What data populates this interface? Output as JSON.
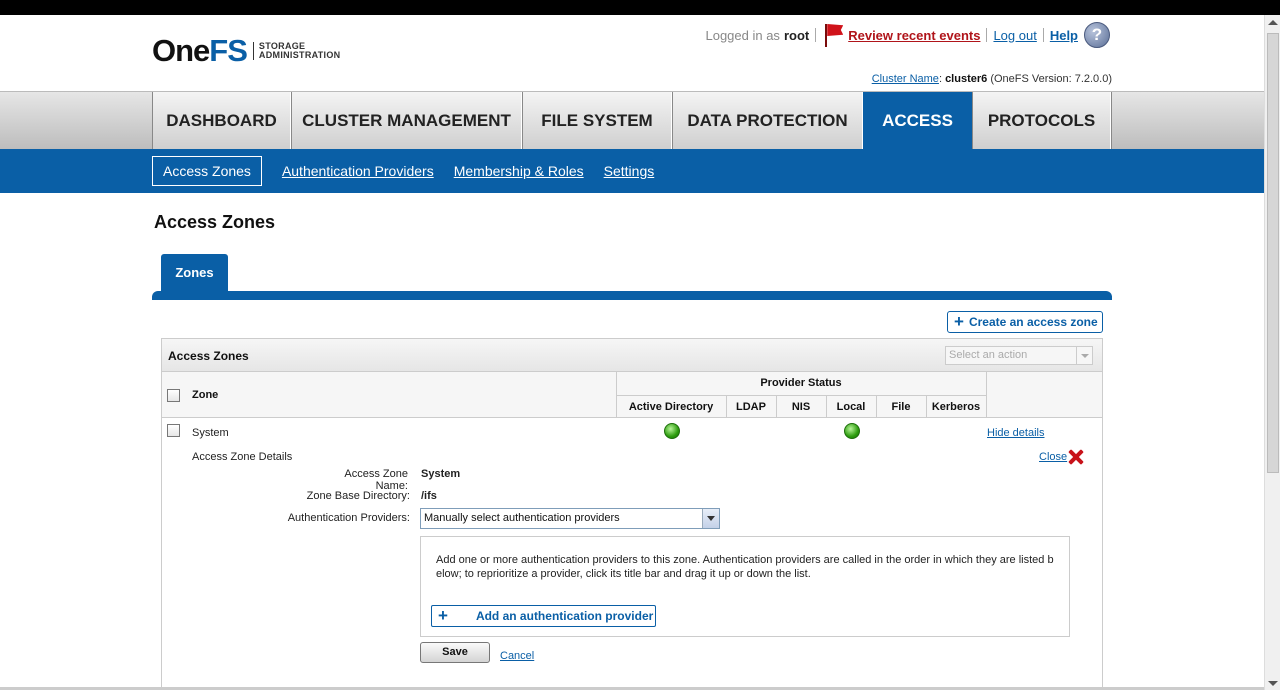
{
  "header": {
    "logo": {
      "one": "One",
      "fs": "FS",
      "sub_line1": "STORAGE",
      "sub_line2": "ADMINISTRATION"
    },
    "logged_in_label": "Logged in as",
    "username": "root",
    "review_events": "Review recent events",
    "logout": "Log out",
    "help": "Help",
    "help_glyph": "?",
    "cluster_name_label": "Cluster Name",
    "cluster_name": "cluster6",
    "version_text": "(OneFS Version: 7.2.0.0)"
  },
  "main_nav": {
    "tabs": [
      {
        "label": "DASHBOARD"
      },
      {
        "label": "CLUSTER MANAGEMENT"
      },
      {
        "label": "FILE SYSTEM"
      },
      {
        "label": "DATA PROTECTION"
      },
      {
        "label": "ACCESS",
        "active": true
      },
      {
        "label": "PROTOCOLS"
      }
    ]
  },
  "sub_nav": {
    "items": [
      {
        "label": "Access Zones",
        "active": true
      },
      {
        "label": "Authentication Providers"
      },
      {
        "label": "Membership & Roles"
      },
      {
        "label": "Settings"
      }
    ]
  },
  "page_title": "Access Zones",
  "zones_tab": "Zones",
  "create_button": "Create an access zone",
  "panel": {
    "title": "Access Zones",
    "action_placeholder": "Select an action",
    "columns": {
      "zone": "Zone",
      "provider_status": "Provider Status",
      "providers": [
        "Active Directory",
        "LDAP",
        "NIS",
        "Local",
        "File",
        "Kerberos"
      ]
    },
    "rows": [
      {
        "zone": "System",
        "status": {
          "Active Directory": "green",
          "Local": "green"
        },
        "hide_details": "Hide details"
      }
    ]
  },
  "details": {
    "title": "Access Zone Details",
    "close": "Close",
    "zone_name_label": "Access Zone Name:",
    "zone_name": "System",
    "base_dir_label": "Zone Base Directory:",
    "base_dir": "/ifs",
    "auth_label": "Authentication Providers:",
    "auth_value": "Manually select authentication providers",
    "help_text": "Add one or more authentication providers to this zone. Authentication providers are called in the order in which they are listed b elow; to reprioritize a provider, click its title bar and drag it up or down the list.",
    "add_provider": "Add an authentication provider",
    "save": "Save",
    "cancel": "Cancel"
  },
  "colors": {
    "brand_blue": "#0a5fa6",
    "alert_red": "#b0141a",
    "status_green": "#2e9d0f"
  },
  "icons": [
    "flag-icon",
    "help-icon",
    "plus-icon",
    "close-icon",
    "dropdown-arrow-icon",
    "status-green-icon"
  ]
}
